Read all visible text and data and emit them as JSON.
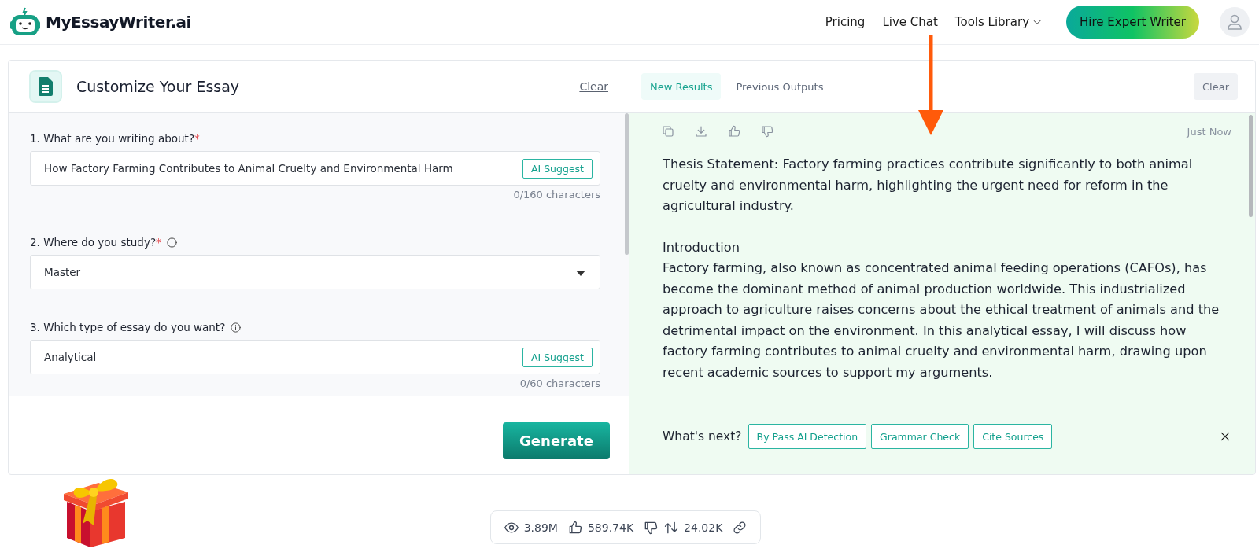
{
  "header": {
    "brand": "MyEssayWriter.ai",
    "nav": [
      {
        "label": "Pricing",
        "kind": "link"
      },
      {
        "label": "Live Chat",
        "kind": "link"
      },
      {
        "label": "Tools Library",
        "kind": "dropdown"
      }
    ],
    "cta": "Hire Expert Writer"
  },
  "form_panel": {
    "title": "Customize Your Essay",
    "clear": "Clear",
    "fields": [
      {
        "label": "1. What are you writing about?",
        "required_mark": "*",
        "info": false,
        "kind": "text",
        "value": "How Factory Farming Contributes to Animal Cruelty and Environmental Harm",
        "suggest": "AI Suggest",
        "counter": "0/160 characters"
      },
      {
        "label": "2. Where do you study?",
        "required_mark": "*",
        "info": true,
        "kind": "select",
        "value": "Master"
      },
      {
        "label": "3. Which type of essay do you want?",
        "info": true,
        "kind": "text",
        "value": "Analytical",
        "suggest": "AI Suggest",
        "counter": "0/60 characters"
      }
    ],
    "generate": "Generate"
  },
  "results_panel": {
    "tabs": [
      {
        "label": "New Results",
        "selected": true
      },
      {
        "label": "Previous Outputs",
        "selected": false
      }
    ],
    "clear": "Clear",
    "timestamp": "Just Now",
    "paragraphs": [
      "Thesis Statement: Factory farming practices contribute significantly to both animal cruelty and environmental harm, highlighting the urgent need for reform in the agricultural industry.",
      "Introduction\nFactory farming, also known as concentrated animal feeding operations (CAFOs), has become the dominant method of animal production worldwide. This industrialized approach to agriculture raises concerns about the ethical treatment of animals and the detrimental impact on the environment. In this analytical essay, I will discuss how factory farming contributes to animal cruelty and environmental harm, drawing upon recent academic sources to support my arguments."
    ],
    "whats_next": "What's next?",
    "next_actions": [
      "By Pass AI Detection",
      "Grammar Check",
      "Cite Sources"
    ]
  },
  "stats": {
    "views": "3.89M",
    "likes": "589.74K",
    "shares": "24.02K"
  }
}
